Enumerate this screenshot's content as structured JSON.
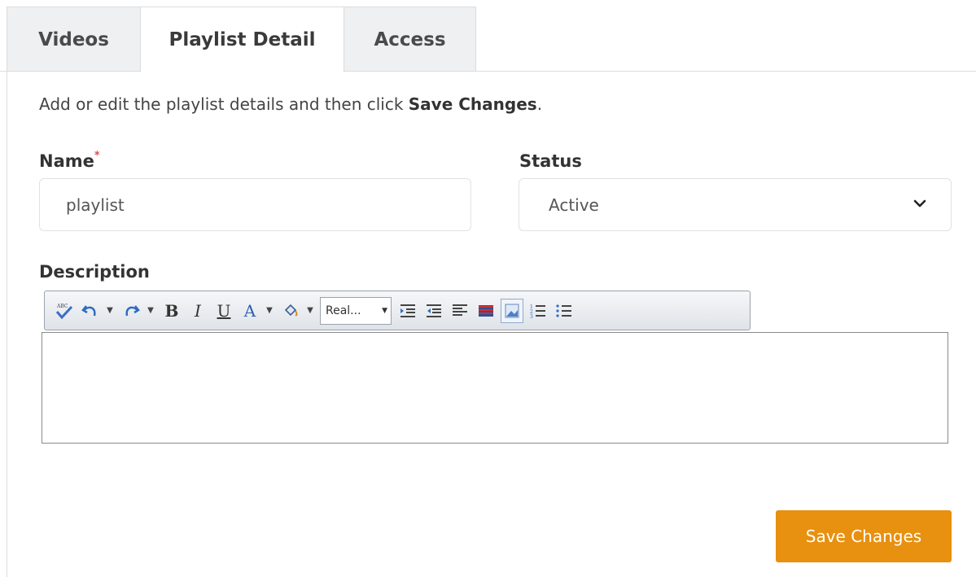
{
  "tabs": [
    {
      "label": "Videos",
      "active": false
    },
    {
      "label": "Playlist Detail",
      "active": true
    },
    {
      "label": "Access",
      "active": false
    }
  ],
  "intro": {
    "prefix": "Add or edit the playlist details and then click ",
    "emphasis": "Save Changes",
    "suffix": "."
  },
  "name_field": {
    "label": "Name",
    "required_marker": "*",
    "value": "playlist"
  },
  "status_field": {
    "label": "Status",
    "selected": "Active"
  },
  "description": {
    "label": "Description",
    "toolbar": {
      "buttons": [
        "spellcheck-icon",
        "undo-icon",
        "redo-icon",
        "bold-icon",
        "italic-icon",
        "underline-icon",
        "font-color-icon",
        "highlight-icon",
        "indent-icon",
        "outdent-icon",
        "align-left-icon",
        "flag-icon",
        "image-icon",
        "ordered-list-icon",
        "unordered-list-icon"
      ],
      "bold_glyph": "B",
      "italic_glyph": "I",
      "underline_glyph": "U",
      "font_color_glyph": "A",
      "font_select": "Real..."
    },
    "value": ""
  },
  "save_button": {
    "label": "Save Changes",
    "color": "#e8900f"
  }
}
